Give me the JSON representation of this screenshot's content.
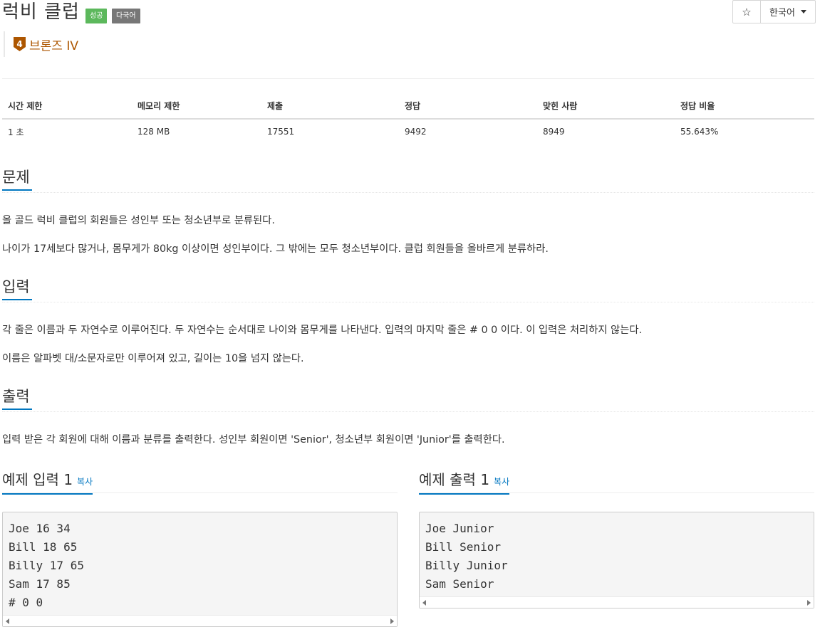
{
  "problem": {
    "title": "럭비 클럽",
    "badges": {
      "success": "성공",
      "multilang": "다국어"
    },
    "tier": {
      "number": "4",
      "label": "브론즈 IV"
    }
  },
  "toolbar": {
    "star": "☆",
    "language": "한국어"
  },
  "info_table": {
    "headers": [
      "시간 제한",
      "메모리 제한",
      "제출",
      "정답",
      "맞힌 사람",
      "정답 비율"
    ],
    "values": [
      "1 초",
      "128 MB",
      "17551",
      "9492",
      "8949",
      "55.643%"
    ]
  },
  "sections": {
    "problem": {
      "heading": "문제",
      "paragraphs": [
        "올 골드 럭비 클럽의 회원들은 성인부 또는 청소년부로 분류된다.",
        "나이가 17세보다 많거나, 몸무게가 80kg 이상이면 성인부이다. 그 밖에는 모두 청소년부이다. 클럽 회원들을 올바르게 분류하라."
      ]
    },
    "input": {
      "heading": "입력",
      "paragraphs": [
        "각 줄은 이름과 두 자연수로 이루어진다. 두 자연수는 순서대로 나이와 몸무게를 나타낸다. 입력의 마지막 줄은 # 0 0 이다. 이 입력은 처리하지 않는다.",
        "이름은 알파벳 대/소문자로만 이루어져 있고, 길이는 10을 넘지 않는다."
      ]
    },
    "output": {
      "heading": "출력",
      "paragraphs": [
        "입력 받은 각 회원에 대해 이름과 분류를 출력한다. 성인부 회원이면 'Senior', 청소년부 회원이면 'Junior'를 출력한다."
      ]
    }
  },
  "samples": {
    "input": {
      "heading": "예제 입력 1",
      "copy": "복사",
      "text": "Joe 16 34\nBill 18 65\nBilly 17 65\nSam 17 85\n# 0 0"
    },
    "output": {
      "heading": "예제 출력 1",
      "copy": "복사",
      "text": "Joe Junior\nBill Senior\nBilly Junior\nSam Senior"
    }
  }
}
